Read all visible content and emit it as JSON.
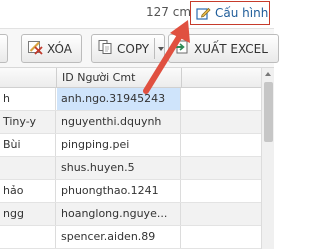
{
  "status": {
    "dimension_text": "127 cm"
  },
  "config_button": {
    "label": "Cấu hình",
    "icon": "edit-icon"
  },
  "toolbar": {
    "delete_label": "XÓA",
    "copy_label": "COPY",
    "export_label": "XUẤT EXCEL"
  },
  "table": {
    "columns": [
      "",
      "ID Người Cmt",
      ""
    ],
    "rows": [
      {
        "name": "h",
        "id": "anh.ngo.31945243",
        "selected": true
      },
      {
        "name": "Tiny-y",
        "id": "nguyenthi.dquynh"
      },
      {
        "name": "Bùi",
        "id": "pingping.pei"
      },
      {
        "name": "",
        "id": "shus.huyen.5"
      },
      {
        "name": "hảo",
        "id": "phuongthao.1241"
      },
      {
        "name": "ngg",
        "id": "hoanglong.nguye..."
      },
      {
        "name": "",
        "id": "spencer.aiden.89"
      }
    ]
  },
  "colors": {
    "accent_red": "#e05040",
    "selection": "#cfe4fb",
    "link_blue": "#1f5d9a"
  }
}
